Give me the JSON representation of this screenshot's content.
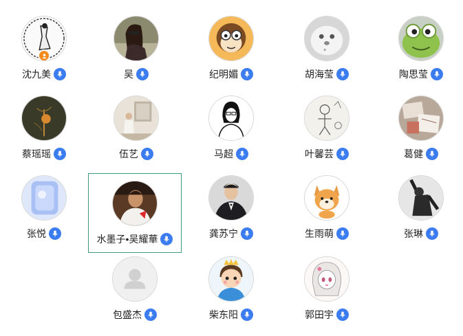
{
  "participants": [
    {
      "name": "沈九美",
      "avatar": "sketch-figure-avatar",
      "host": true
    },
    {
      "name": "吴",
      "avatar": "woman-photo-avatar"
    },
    {
      "name": "纪明媚",
      "avatar": "cartoon-monkey-avatar"
    },
    {
      "name": "胡海莹",
      "avatar": "white-plush-avatar"
    },
    {
      "name": "陶思莹",
      "avatar": "green-frog-avatar"
    },
    {
      "name": "蔡瑶瑶",
      "avatar": "dark-plant-avatar"
    },
    {
      "name": "伍艺",
      "avatar": "gallery-photo-avatar"
    },
    {
      "name": "马超",
      "avatar": "line-drawing-avatar"
    },
    {
      "name": "叶馨芸",
      "avatar": "child-drawing-avatar"
    },
    {
      "name": "葛健",
      "avatar": "paper-art-avatar"
    },
    {
      "name": "张悦",
      "avatar": "blue-glass-avatar"
    },
    {
      "name": "水墨子•吴耀華",
      "avatar": "man-photo-avatar",
      "selected": true
    },
    {
      "name": "龚苏宁",
      "avatar": "suit-man-avatar"
    },
    {
      "name": "生雨萌",
      "avatar": "cartoon-dog-avatar"
    },
    {
      "name": "张琳",
      "avatar": "bw-dancer-avatar"
    },
    {
      "name": "包盛杰",
      "avatar": "default-person-avatar"
    },
    {
      "name": "柴东阳",
      "avatar": "cartoon-prince-avatar"
    },
    {
      "name": "郭田宇",
      "avatar": "anime-girl-avatar"
    }
  ],
  "colors": {
    "mic": "#3b7cf0",
    "host_badge": "#f28a1e",
    "selection_border": "#3a9a7c"
  }
}
